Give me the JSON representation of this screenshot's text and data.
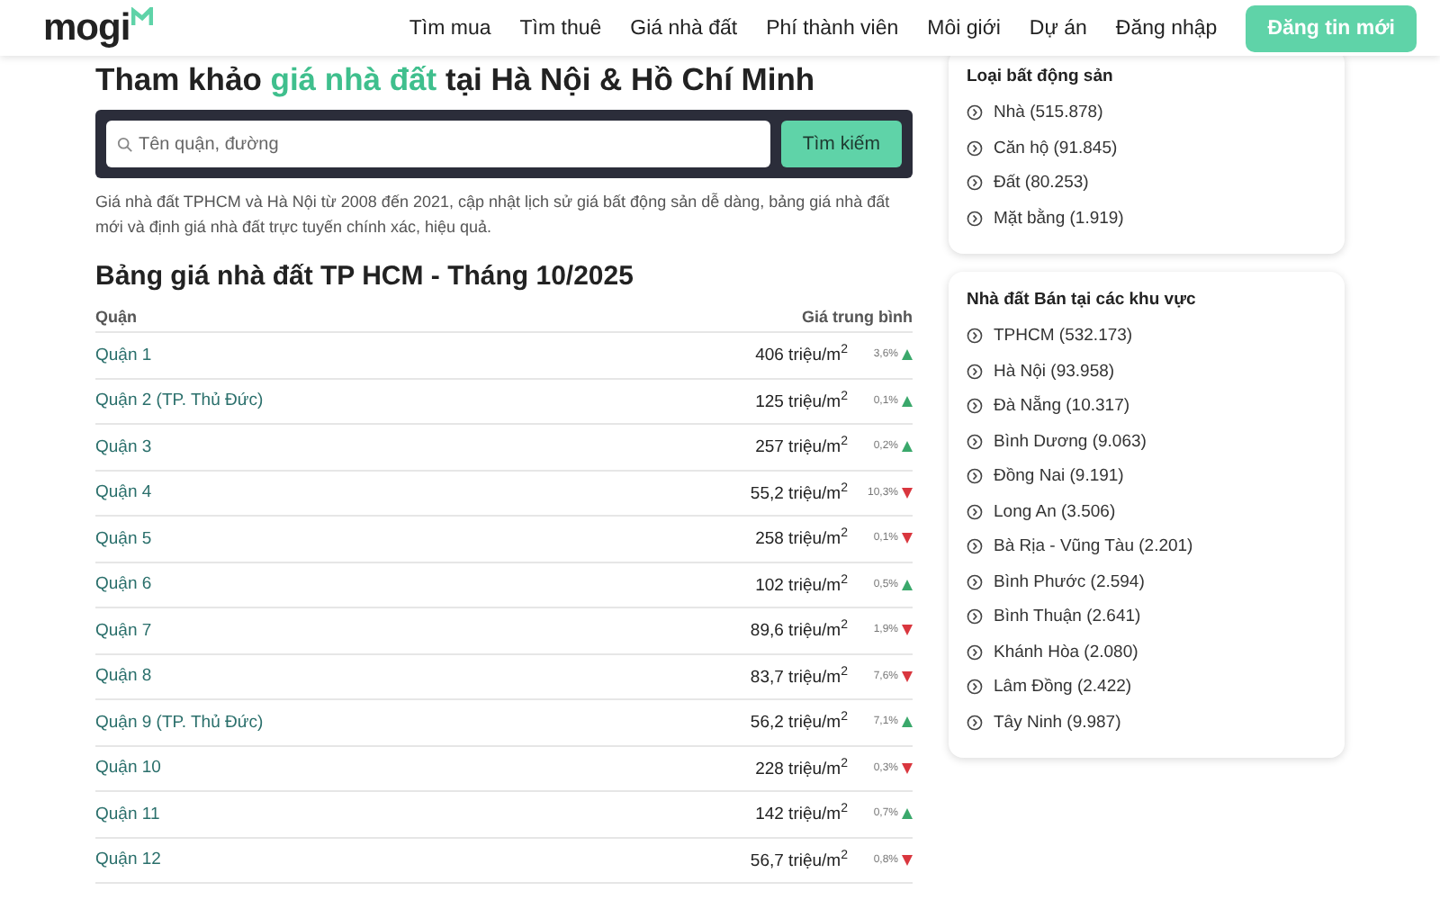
{
  "header": {
    "logo": "mogi",
    "nav": [
      "Tìm mua",
      "Tìm thuê",
      "Giá nhà đất",
      "Phí thành viên",
      "Môi giới",
      "Dự án",
      "Đăng nhập"
    ],
    "post_button": "Đăng tin mới"
  },
  "hero": {
    "title_before": "Tham khảo ",
    "title_highlight": "giá nhà đất",
    "title_after": " tại Hà Nội & Hồ Chí Minh",
    "search": {
      "placeholder": "Tên quận, đường",
      "button": "Tìm kiếm"
    },
    "description": "Giá nhà đất TPHCM và Hà Nội từ 2008 đến 2021, cập nhật lịch sử giá bất động sản dễ dàng, bảng giá nhà đất mới và định giá nhà đất trực tuyến chính xác, hiệu quả."
  },
  "table": {
    "title": "Bảng giá nhà đất TP HCM - Tháng 10/2025",
    "columns": [
      "Quận",
      "Giá trung bình"
    ],
    "rows": [
      {
        "district": "Quận 1",
        "price": "406 triệu/m$^{2}$",
        "change": "3,6%",
        "kind": "up"
      },
      {
        "district": "Quận 2 (TP. Thủ Đức)",
        "price": "125 triệu/m$^{2}$",
        "change": "0,1%",
        "kind": "up"
      },
      {
        "district": "Quận 3",
        "price": "257 triệu/m$^{2}$",
        "change": "0,2%",
        "kind": "up"
      },
      {
        "district": "Quận 4",
        "price": "55,2 triệu/m$^{2}$",
        "change": "10,3%",
        "kind": "down"
      },
      {
        "district": "Quận 5",
        "price": "258 triệu/m$^{2}$",
        "change": "0,1%",
        "kind": "down"
      },
      {
        "district": "Quận 6",
        "price": "102 triệu/m$^{2}$",
        "change": "0,5%",
        "kind": "up"
      },
      {
        "district": "Quận 7",
        "price": "89,6 triệu/m$^{2}$",
        "change": "1,9%",
        "kind": "down"
      },
      {
        "district": "Quận 8",
        "price": "83,7 triệu/m$^{2}$",
        "change": "7,6%",
        "kind": "down"
      },
      {
        "district": "Quận 9 (TP. Thủ Đức)",
        "price": "56,2 triệu/m$^{2}$",
        "change": "7,1%",
        "kind": "up"
      },
      {
        "district": "Quận 10",
        "price": "228 triệu/m$^{2}$",
        "change": "0,3%",
        "kind": "down"
      },
      {
        "district": "Quận 11",
        "price": "142 triệu/m$^{2}$",
        "change": "0,7%",
        "kind": "up"
      },
      {
        "district": "Quận 12",
        "price": "56,7 triệu/m$^{2}$",
        "change": "0,8%",
        "kind": "down"
      }
    ]
  },
  "sidebar": [
    {
      "title": "Loại bất động sản",
      "items": [
        "Nhà (515.878)",
        "Căn hộ (91.845)",
        "Đất (80.253)",
        "Mặt bằng (1.919)"
      ]
    },
    {
      "title": "Nhà đất Bán tại các khu vực",
      "items": [
        "TPHCM (532.173)",
        "Hà Nội (93.958)",
        "Đà Nẵng (10.317)",
        "Bình Dương (9.063)",
        "Đồng Nai (9.191)",
        "Long An (3.506)",
        "Bà Rịa - Vũng Tàu (2.201)",
        "Bình Phước (2.594)",
        "Bình Thuận (2.641)",
        "Khánh Hòa (2.080)",
        "Lâm Đồng (2.422)",
        "Tây Ninh (9.987)"
      ]
    }
  ]
}
